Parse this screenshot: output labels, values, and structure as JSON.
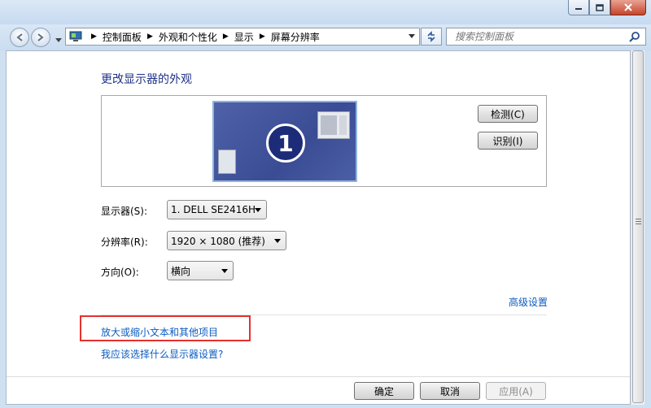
{
  "window": {
    "minimize_label": "minimize",
    "maximize_label": "maximize",
    "close_label": "close"
  },
  "nav": {
    "breadcrumb": [
      "控制面板",
      "外观和个性化",
      "显示",
      "屏幕分辨率"
    ],
    "search_placeholder": "搜索控制面板"
  },
  "main": {
    "heading": "更改显示器的外观",
    "preview": {
      "monitor_number": "1"
    },
    "detect_label": "检测(C)",
    "identify_label": "识别(I)",
    "display_label": "显示器(S):",
    "display_value": "1. DELL SE2416H",
    "resolution_label": "分辨率(R):",
    "resolution_value": "1920 × 1080 (推荐)",
    "orientation_label": "方向(O):",
    "orientation_value": "横向",
    "advanced_link": "高级设置",
    "text_size_link": "放大或缩小文本和其他项目",
    "help_link": "我应该选择什么显示器设置?"
  },
  "footer": {
    "ok_label": "确定",
    "cancel_label": "取消",
    "apply_label": "应用(A)"
  },
  "colors": {
    "link": "#0c5cc0",
    "heading": "#1e3287",
    "highlight": "#e5312d"
  }
}
